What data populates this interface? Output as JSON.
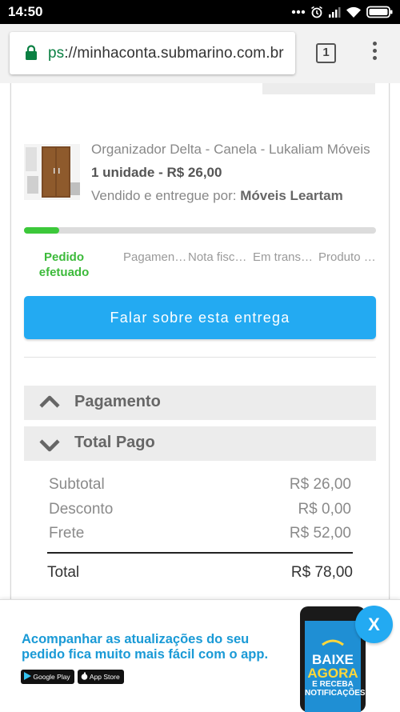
{
  "status_bar": {
    "time": "14:50"
  },
  "browser": {
    "url_scheme_fragment": "ps",
    "url_rest": "://minhaconta.submarino.com.br",
    "tab_count": "1"
  },
  "order": {
    "product_name": "Organizador Delta - Canela - Lukaliam Móveis",
    "quantity_price": "1 unidade - R$ 26,00",
    "seller_prefix": "Vendido e entregue por: ",
    "seller_name": "Móveis Leartam",
    "progress_fraction": 0.1,
    "steps": [
      {
        "label": "Pedido efetuado",
        "active": true
      },
      {
        "label": "Pagamento aprovado",
        "active": false
      },
      {
        "label": "Nota fiscal emitida",
        "active": false
      },
      {
        "label": "Em transporte",
        "active": false
      },
      {
        "label": "Produto entregue",
        "active": false
      }
    ],
    "talk_button": "Falar sobre esta entrega"
  },
  "payment": {
    "accordion_pagamento": "Pagamento",
    "accordion_total_pago": "Total Pago",
    "rows": [
      {
        "label": "Subtotal",
        "value": "R$ 26,00"
      },
      {
        "label": "Desconto",
        "value": "R$ 0,00"
      },
      {
        "label": "Frete",
        "value": "R$ 52,00"
      }
    ],
    "total_label": "Total",
    "total_value": "R$ 78,00"
  },
  "banner": {
    "message": "Acompanhar as atualizações do seu pedido fica muito mais fácil com o app.",
    "google_play": "Google Play",
    "app_store": "App Store",
    "phone_line1": "BAIXE",
    "phone_line2": "AGORA",
    "phone_line3": "E RECEBA NOTIFICAÇÕES!",
    "close_label": "X"
  },
  "colors": {
    "accent_blue": "#23aaf2",
    "success_green": "#3cc83a",
    "secure_green": "#0b8043"
  }
}
